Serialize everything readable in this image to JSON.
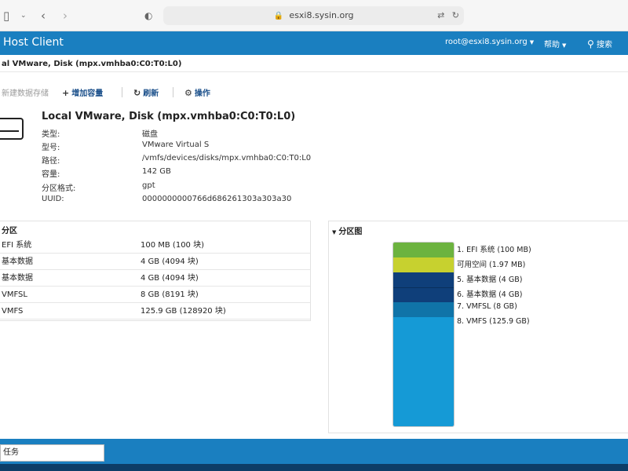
{
  "browser": {
    "url": "esxi8.sysin.org",
    "icons": [
      "sidebar-icon",
      "chevron-down-icon",
      "back-icon",
      "forward-icon",
      "shield-icon",
      "lock-icon",
      "translate-icon",
      "reload-icon"
    ]
  },
  "header": {
    "title": "Host Client",
    "user": "root@esxi8.sysin.org",
    "help": "帮助",
    "search": "搜索"
  },
  "breadcrumb": "al VMware, Disk (mpx.vmhba0:C0:T0:L0)",
  "toolbar": {
    "new_datastore": "新建数据存储",
    "increase_capacity": "增加容量",
    "refresh": "刷新",
    "actions": "操作"
  },
  "summary": {
    "title": "Local VMware, Disk (mpx.vmhba0:C0:T0:L0)",
    "props": [
      {
        "label": "类型:",
        "value": "磁盘"
      },
      {
        "label": "型号:",
        "value": "VMware Virtual S"
      },
      {
        "label": "路径:",
        "value": "/vmfs/devices/disks/mpx.vmhba0:C0:T0:L0"
      },
      {
        "label": "容量:",
        "value": "142 GB"
      },
      {
        "label": "分区格式:",
        "value": "gpt"
      },
      {
        "label": "UUID:",
        "value": "0000000000766d686261303a303a30"
      }
    ]
  },
  "partitions": {
    "title": "分区",
    "rows": [
      {
        "name": "EFI 系统",
        "size": "100 MB (100 块)"
      },
      {
        "name": "基本数据",
        "size": "4 GB (4094 块)"
      },
      {
        "name": "基本数据",
        "size": "4 GB (4094 块)"
      },
      {
        "name": "VMFSL",
        "size": "8 GB (8191 块)"
      },
      {
        "name": "VMFS",
        "size": "125.9 GB (128920 块)"
      }
    ]
  },
  "diagram": {
    "title": "分区图",
    "colors": [
      "#6cb33f",
      "#c7d12f",
      "#0f3f7a",
      "#0f3f7a",
      "#1074a8",
      "#159ad6"
    ],
    "legend": [
      "1. EFI 系统  (100 MB)",
      "可用空间  (1.97 MB)",
      "5. 基本数据  (4 GB)",
      "6. 基本数据  (4 GB)",
      "7. VMFSL  (8 GB)",
      "8. VMFS  (125.9 GB)"
    ]
  },
  "bottom": {
    "task_tab": "任务"
  }
}
